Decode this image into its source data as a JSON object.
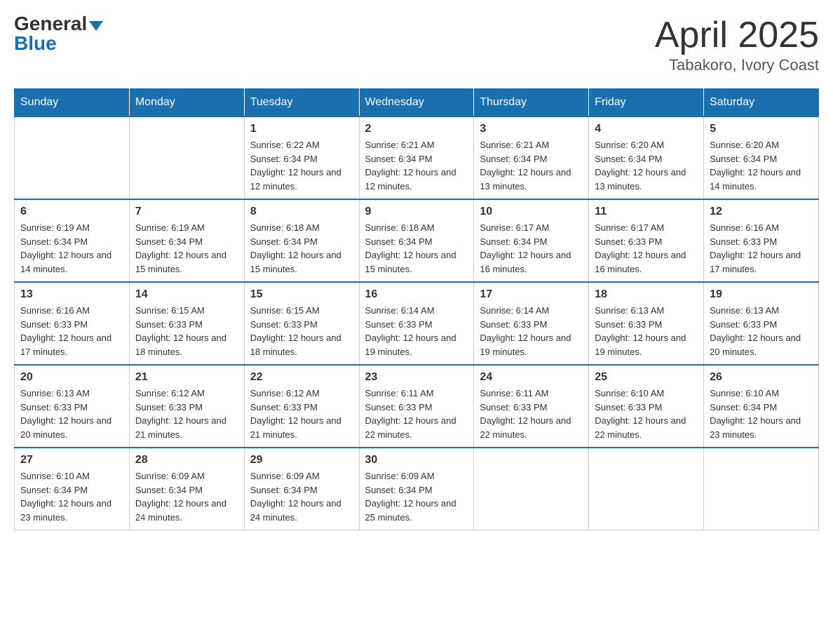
{
  "logo": {
    "general": "General",
    "blue": "Blue"
  },
  "title": "April 2025",
  "subtitle": "Tabakoro, Ivory Coast",
  "days_of_week": [
    "Sunday",
    "Monday",
    "Tuesday",
    "Wednesday",
    "Thursday",
    "Friday",
    "Saturday"
  ],
  "weeks": [
    [
      {
        "day": "",
        "sunrise": "",
        "sunset": "",
        "daylight": ""
      },
      {
        "day": "",
        "sunrise": "",
        "sunset": "",
        "daylight": ""
      },
      {
        "day": "1",
        "sunrise": "Sunrise: 6:22 AM",
        "sunset": "Sunset: 6:34 PM",
        "daylight": "Daylight: 12 hours and 12 minutes."
      },
      {
        "day": "2",
        "sunrise": "Sunrise: 6:21 AM",
        "sunset": "Sunset: 6:34 PM",
        "daylight": "Daylight: 12 hours and 12 minutes."
      },
      {
        "day": "3",
        "sunrise": "Sunrise: 6:21 AM",
        "sunset": "Sunset: 6:34 PM",
        "daylight": "Daylight: 12 hours and 13 minutes."
      },
      {
        "day": "4",
        "sunrise": "Sunrise: 6:20 AM",
        "sunset": "Sunset: 6:34 PM",
        "daylight": "Daylight: 12 hours and 13 minutes."
      },
      {
        "day": "5",
        "sunrise": "Sunrise: 6:20 AM",
        "sunset": "Sunset: 6:34 PM",
        "daylight": "Daylight: 12 hours and 14 minutes."
      }
    ],
    [
      {
        "day": "6",
        "sunrise": "Sunrise: 6:19 AM",
        "sunset": "Sunset: 6:34 PM",
        "daylight": "Daylight: 12 hours and 14 minutes."
      },
      {
        "day": "7",
        "sunrise": "Sunrise: 6:19 AM",
        "sunset": "Sunset: 6:34 PM",
        "daylight": "Daylight: 12 hours and 15 minutes."
      },
      {
        "day": "8",
        "sunrise": "Sunrise: 6:18 AM",
        "sunset": "Sunset: 6:34 PM",
        "daylight": "Daylight: 12 hours and 15 minutes."
      },
      {
        "day": "9",
        "sunrise": "Sunrise: 6:18 AM",
        "sunset": "Sunset: 6:34 PM",
        "daylight": "Daylight: 12 hours and 15 minutes."
      },
      {
        "day": "10",
        "sunrise": "Sunrise: 6:17 AM",
        "sunset": "Sunset: 6:34 PM",
        "daylight": "Daylight: 12 hours and 16 minutes."
      },
      {
        "day": "11",
        "sunrise": "Sunrise: 6:17 AM",
        "sunset": "Sunset: 6:33 PM",
        "daylight": "Daylight: 12 hours and 16 minutes."
      },
      {
        "day": "12",
        "sunrise": "Sunrise: 6:16 AM",
        "sunset": "Sunset: 6:33 PM",
        "daylight": "Daylight: 12 hours and 17 minutes."
      }
    ],
    [
      {
        "day": "13",
        "sunrise": "Sunrise: 6:16 AM",
        "sunset": "Sunset: 6:33 PM",
        "daylight": "Daylight: 12 hours and 17 minutes."
      },
      {
        "day": "14",
        "sunrise": "Sunrise: 6:15 AM",
        "sunset": "Sunset: 6:33 PM",
        "daylight": "Daylight: 12 hours and 18 minutes."
      },
      {
        "day": "15",
        "sunrise": "Sunrise: 6:15 AM",
        "sunset": "Sunset: 6:33 PM",
        "daylight": "Daylight: 12 hours and 18 minutes."
      },
      {
        "day": "16",
        "sunrise": "Sunrise: 6:14 AM",
        "sunset": "Sunset: 6:33 PM",
        "daylight": "Daylight: 12 hours and 19 minutes."
      },
      {
        "day": "17",
        "sunrise": "Sunrise: 6:14 AM",
        "sunset": "Sunset: 6:33 PM",
        "daylight": "Daylight: 12 hours and 19 minutes."
      },
      {
        "day": "18",
        "sunrise": "Sunrise: 6:13 AM",
        "sunset": "Sunset: 6:33 PM",
        "daylight": "Daylight: 12 hours and 19 minutes."
      },
      {
        "day": "19",
        "sunrise": "Sunrise: 6:13 AM",
        "sunset": "Sunset: 6:33 PM",
        "daylight": "Daylight: 12 hours and 20 minutes."
      }
    ],
    [
      {
        "day": "20",
        "sunrise": "Sunrise: 6:13 AM",
        "sunset": "Sunset: 6:33 PM",
        "daylight": "Daylight: 12 hours and 20 minutes."
      },
      {
        "day": "21",
        "sunrise": "Sunrise: 6:12 AM",
        "sunset": "Sunset: 6:33 PM",
        "daylight": "Daylight: 12 hours and 21 minutes."
      },
      {
        "day": "22",
        "sunrise": "Sunrise: 6:12 AM",
        "sunset": "Sunset: 6:33 PM",
        "daylight": "Daylight: 12 hours and 21 minutes."
      },
      {
        "day": "23",
        "sunrise": "Sunrise: 6:11 AM",
        "sunset": "Sunset: 6:33 PM",
        "daylight": "Daylight: 12 hours and 22 minutes."
      },
      {
        "day": "24",
        "sunrise": "Sunrise: 6:11 AM",
        "sunset": "Sunset: 6:33 PM",
        "daylight": "Daylight: 12 hours and 22 minutes."
      },
      {
        "day": "25",
        "sunrise": "Sunrise: 6:10 AM",
        "sunset": "Sunset: 6:33 PM",
        "daylight": "Daylight: 12 hours and 22 minutes."
      },
      {
        "day": "26",
        "sunrise": "Sunrise: 6:10 AM",
        "sunset": "Sunset: 6:34 PM",
        "daylight": "Daylight: 12 hours and 23 minutes."
      }
    ],
    [
      {
        "day": "27",
        "sunrise": "Sunrise: 6:10 AM",
        "sunset": "Sunset: 6:34 PM",
        "daylight": "Daylight: 12 hours and 23 minutes."
      },
      {
        "day": "28",
        "sunrise": "Sunrise: 6:09 AM",
        "sunset": "Sunset: 6:34 PM",
        "daylight": "Daylight: 12 hours and 24 minutes."
      },
      {
        "day": "29",
        "sunrise": "Sunrise: 6:09 AM",
        "sunset": "Sunset: 6:34 PM",
        "daylight": "Daylight: 12 hours and 24 minutes."
      },
      {
        "day": "30",
        "sunrise": "Sunrise: 6:09 AM",
        "sunset": "Sunset: 6:34 PM",
        "daylight": "Daylight: 12 hours and 25 minutes."
      },
      {
        "day": "",
        "sunrise": "",
        "sunset": "",
        "daylight": ""
      },
      {
        "day": "",
        "sunrise": "",
        "sunset": "",
        "daylight": ""
      },
      {
        "day": "",
        "sunrise": "",
        "sunset": "",
        "daylight": ""
      }
    ]
  ]
}
